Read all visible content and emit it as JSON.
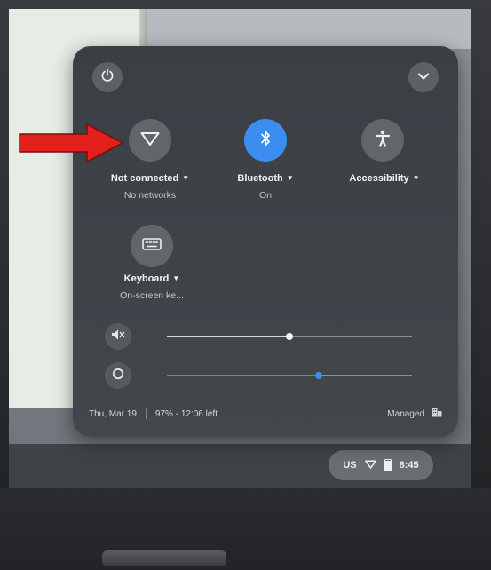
{
  "annotation": {
    "arrow_color": "#e3201b"
  },
  "quick_settings": {
    "tiles": [
      {
        "label": "Not connected",
        "sublabel": "No networks",
        "icon": "wifi-icon",
        "active": false
      },
      {
        "label": "Bluetooth",
        "sublabel": "On",
        "icon": "bluetooth-icon",
        "active": true
      },
      {
        "label": "Accessibility",
        "sublabel": "",
        "icon": "accessibility-icon",
        "active": false
      },
      {
        "label": "Keyboard",
        "sublabel": "On-screen ke...",
        "icon": "keyboard-icon",
        "active": false
      }
    ],
    "volume": {
      "icon": "volume-muted-icon",
      "level": 0.5
    },
    "brightness": {
      "icon": "brightness-icon",
      "level": 0.62
    },
    "footer": {
      "date": "Thu, Mar 19",
      "battery": "97% - 12:06 left",
      "managed": "Managed"
    },
    "accent": "#3b8ef0"
  },
  "shelf": {
    "language": "US",
    "time": "8:45"
  }
}
